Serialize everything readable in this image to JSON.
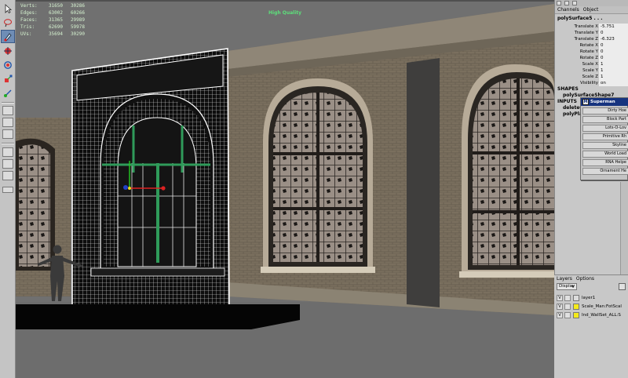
{
  "hud": {
    "stats": [
      {
        "label": "Verts:",
        "a": "31650",
        "b": "30286"
      },
      {
        "label": "Edges:",
        "a": "63002",
        "b": "60266"
      },
      {
        "label": "Faces:",
        "a": "31365",
        "b": "29989"
      },
      {
        "label": "Tris:",
        "a": "62690",
        "b": "59978"
      },
      {
        "label": "UVs:",
        "a": "35694",
        "b": "30290"
      }
    ],
    "quality": "High Quality"
  },
  "channel_box": {
    "menu": [
      "Channels",
      "Object"
    ],
    "object_name": "polySurface5 . . .",
    "attributes": [
      {
        "name": "Translate X",
        "value": "-5.751"
      },
      {
        "name": "Translate Y",
        "value": "0"
      },
      {
        "name": "Translate Z",
        "value": "-6.323"
      },
      {
        "name": "Rotate X",
        "value": "0"
      },
      {
        "name": "Rotate Y",
        "value": "0"
      },
      {
        "name": "Rotate Z",
        "value": "0"
      },
      {
        "name": "Scale X",
        "value": "1"
      },
      {
        "name": "Scale Y",
        "value": "1"
      },
      {
        "name": "Scale Z",
        "value": "1"
      },
      {
        "name": "Visibility",
        "value": "on"
      }
    ],
    "shapes_heading": "SHAPES",
    "shape_name": "polySurfaceShape7",
    "inputs_heading": "INPUTS",
    "inputs": [
      "deleteC",
      "polyPlar"
    ]
  },
  "shelf": {
    "title": "Superman Tools",
    "buttons": [
      "Dirty Hoe",
      "Block Part",
      "Lots-O-Lov",
      "Primitive Rh",
      "Skyline",
      "World Load",
      "RNA Helpe",
      "Ornament He"
    ]
  },
  "layers": {
    "menu": [
      "Layers",
      "Options"
    ],
    "display_mode": "Display",
    "rows": [
      {
        "visible": "V",
        "name": "layer1",
        "color": "#dcdcdc"
      },
      {
        "visible": "V",
        "name": "Scale_Man:FotScal",
        "color": "#f4ea1b"
      },
      {
        "visible": "V",
        "name": "Ind_WallSet_ALL:S",
        "color": "#f4ea1b"
      }
    ]
  },
  "toolbox": {
    "tools": [
      "select-tool",
      "lasso-tool",
      "paint-select-tool",
      "move-tool",
      "rotate-tool",
      "scale-tool",
      "manipulator-tool"
    ],
    "active": "paint-select-tool"
  },
  "colors": {
    "viewport_bg": "#6f6f6f",
    "brick": "#7a6f5e",
    "wireframe": "#ffffff",
    "frame_highlight": "#2f9b5a",
    "selection_title": "#16337f"
  }
}
